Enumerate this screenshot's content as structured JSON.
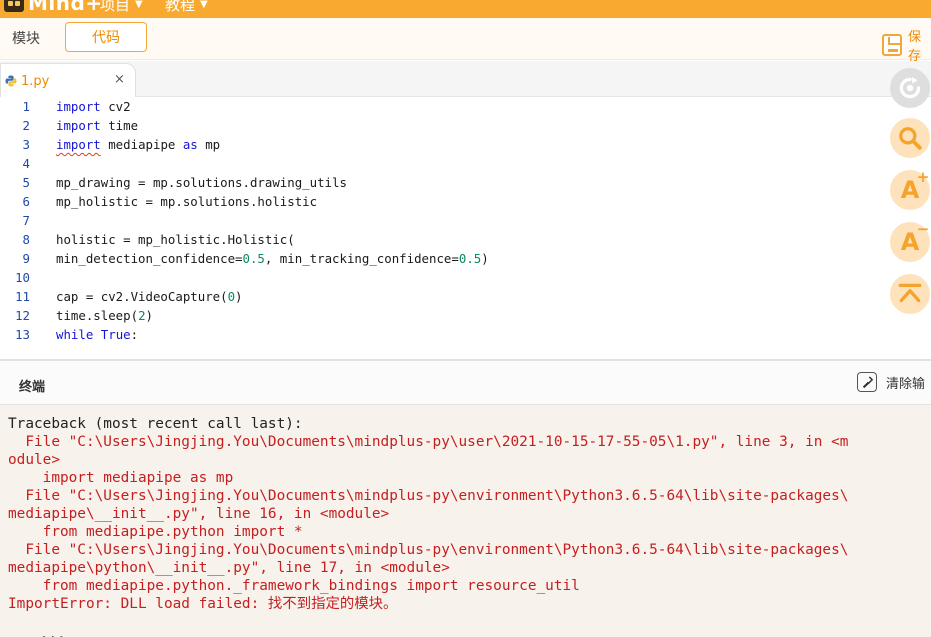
{
  "app": {
    "logo_text": "Mind+",
    "menu": [
      {
        "label": "项目"
      },
      {
        "label": "教程"
      }
    ]
  },
  "mode_tabs": {
    "blocks_label": "模块",
    "code_label": "代码",
    "save_label": "保存"
  },
  "file_tab": {
    "name": "1.py",
    "close_glyph": "×"
  },
  "editor": {
    "lines": [
      {
        "num": "1",
        "text": "import cv2"
      },
      {
        "num": "2",
        "text": "import time"
      },
      {
        "num": "3",
        "text": "import mediapipe as mp"
      },
      {
        "num": "4",
        "text": ""
      },
      {
        "num": "5",
        "text": "mp_drawing = mp.solutions.drawing_utils"
      },
      {
        "num": "6",
        "text": "mp_holistic = mp.solutions.holistic"
      },
      {
        "num": "7",
        "text": ""
      },
      {
        "num": "8",
        "text": "holistic = mp_holistic.Holistic("
      },
      {
        "num": "9",
        "text": "min_detection_confidence=0.5, min_tracking_confidence=0.5)"
      },
      {
        "num": "10",
        "text": ""
      },
      {
        "num": "11",
        "text": "cap = cv2.VideoCapture(0)"
      },
      {
        "num": "12",
        "text": "time.sleep(2)"
      },
      {
        "num": "13",
        "text": "while True:"
      }
    ]
  },
  "toolbar_icons": [
    "refresh-icon",
    "search-icon",
    "font-increase-icon",
    "font-decrease-icon",
    "scroll-to-top-icon"
  ],
  "terminal": {
    "title": "终端",
    "clear_label": "清除输",
    "lines": [
      {
        "text": "Traceback (most recent call last):",
        "kind": "dark"
      },
      {
        "text": "  File \"C:\\Users\\Jingjing.You\\Documents\\mindplus-py\\user\\2021-10-15-17-55-05\\1.py\", line 3, in <m",
        "kind": "error"
      },
      {
        "text": "odule>",
        "kind": "error"
      },
      {
        "text": "    import mediapipe as mp",
        "kind": "error"
      },
      {
        "text": "  File \"C:\\Users\\Jingjing.You\\Documents\\mindplus-py\\environment\\Python3.6.5-64\\lib\\site-packages\\",
        "kind": "error"
      },
      {
        "text": "mediapipe\\__init__.py\", line 16, in <module>",
        "kind": "error"
      },
      {
        "text": "    from mediapipe.python import *",
        "kind": "error"
      },
      {
        "text": "  File \"C:\\Users\\Jingjing.You\\Documents\\mindplus-py\\environment\\Python3.6.5-64\\lib\\site-packages\\",
        "kind": "error"
      },
      {
        "text": "mediapipe\\python\\__init__.py\", line 17, in <module>",
        "kind": "error"
      },
      {
        "text": "    from mediapipe.python._framework_bindings import resource_util",
        "kind": "error"
      },
      {
        "text": "ImportError: DLL load failed: 找不到指定的模块。",
        "kind": "error"
      }
    ],
    "prompt": ">>>"
  },
  "colors": {
    "accent": "#f7a930",
    "accent_text": "#f08a00",
    "keyword": "#1515d6",
    "number": "#0c8a5a",
    "error_text": "#c52020",
    "terminal_bg": "#f7f2ec"
  }
}
